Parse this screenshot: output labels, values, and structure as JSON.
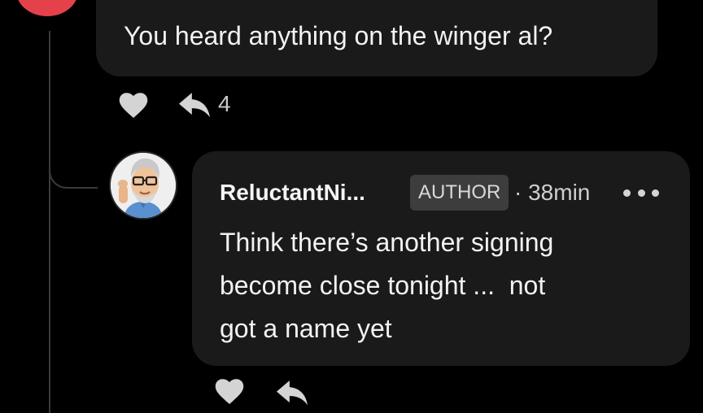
{
  "parent_comment": {
    "text": "You heard anything on the winger al?",
    "reply_count": "4",
    "like_icon": "heart-icon",
    "reply_icon": "reply-arrow-icon"
  },
  "reply_comment": {
    "author": "ReluctantNi...",
    "badge": "AUTHOR",
    "time": "· 38min",
    "more_icon": "more-dots-icon",
    "text_lines": [
      "Think there’s another signing",
      "become close tonight ...  not",
      "got a name yet"
    ],
    "like_icon": "heart-icon",
    "reply_icon": "reply-arrow-icon"
  },
  "colors": {
    "background": "#000000",
    "bubble": "#1a1a1a",
    "badge_bg": "#3d3d3d",
    "icon": "#d4d4d4",
    "parent_avatar": "#e4414b"
  }
}
